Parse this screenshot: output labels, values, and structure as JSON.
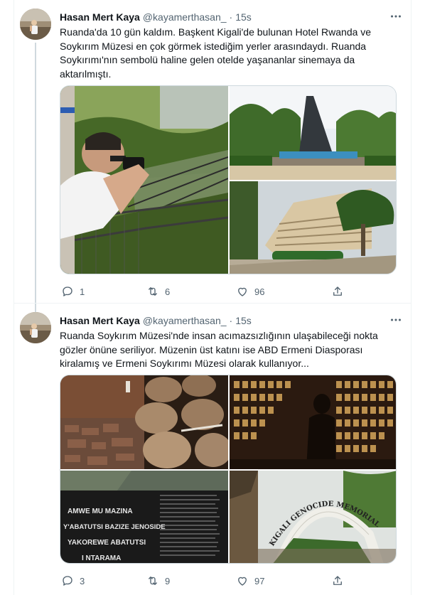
{
  "tweets": [
    {
      "author_name": "Hasan Mert Kaya",
      "handle": "@kayamerthasan_",
      "separator": "·",
      "time": "15s",
      "text": "Ruanda'da 10 gün kaldım. Başkent Kigali'de bulunan Hotel Rwanda ve Soykırım Müzesi en çok görmek istediğim yerler arasındaydı. Ruanda Soykırımı'nın sembolü haline gelen otelde yaşananlar sinemaya da aktarılmıştı.",
      "stats": {
        "replies": "1",
        "retweets": "6",
        "likes": "96"
      }
    },
    {
      "author_name": "Hasan Mert Kaya",
      "handle": "@kayamerthasan_",
      "separator": "·",
      "time": "15s",
      "text": "Ruanda Soykırım Müzesi'nde insan acımazsızlığının ulaşabileceği nokta gözler önüne seriliyor. Müzenin üst katını ise ABD Ermeni Diasporası kiralamış ve Ermeni Soykırımı Müzesi olarak kullanıyor...",
      "stats": {
        "replies": "3",
        "retweets": "9",
        "likes": "97"
      },
      "image_texts": {
        "wall_line1": "AMWE MU MAZINA",
        "wall_line2": "Y'ABATUTSI BAZIZE JENOSIDE",
        "wall_line3": "YAKOREWE ABATUTSI",
        "wall_line4": "I NTARAMA",
        "arch_sign": "KIGALI GENOCIDE MEMORIAL"
      }
    }
  ],
  "icons": {
    "more": "more-horizontal-icon",
    "reply": "reply-icon",
    "retweet": "retweet-icon",
    "like": "heart-icon",
    "share": "share-icon"
  },
  "colors": {
    "text_primary": "#0f1419",
    "text_secondary": "#536471",
    "border": "#cfd9de",
    "thread_line": "#cfd9de"
  }
}
